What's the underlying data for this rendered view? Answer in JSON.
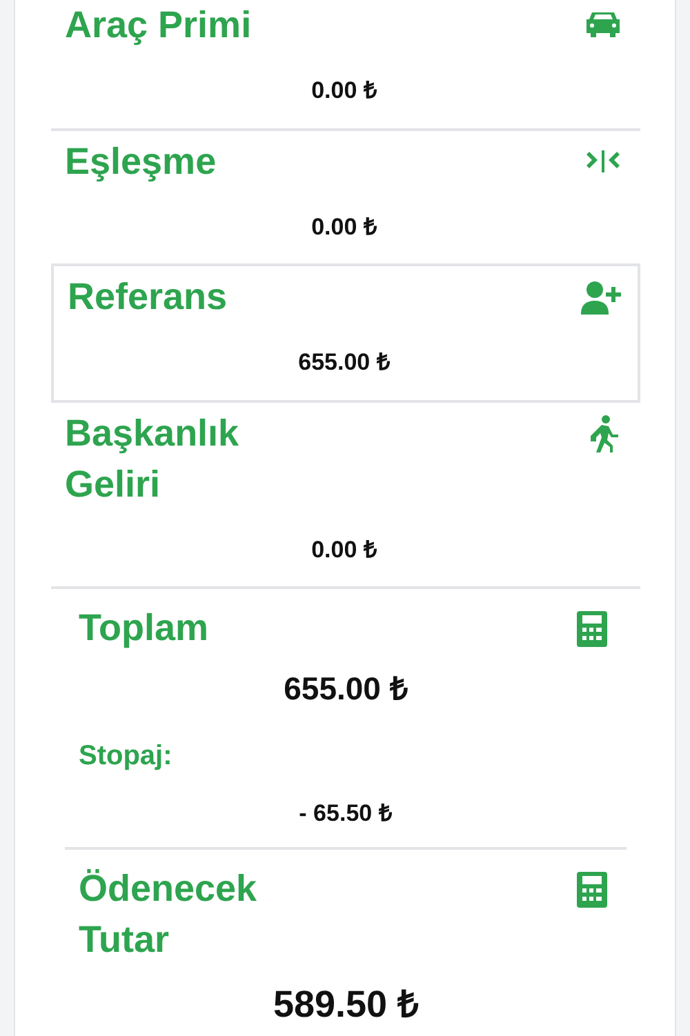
{
  "earnings": [
    {
      "kind": "vehicle",
      "title": "Araç Primi",
      "amount": "0.00 ₺",
      "boxed": false
    },
    {
      "kind": "matching",
      "title": "Eşleşme",
      "amount": "0.00 ₺",
      "boxed": false
    },
    {
      "kind": "referral",
      "title": "Referans",
      "amount": "655.00 ₺",
      "boxed": true
    },
    {
      "kind": "presidency",
      "title": "Başkanlık Geliri",
      "amount": "0.00 ₺",
      "boxed": false
    }
  ],
  "total": {
    "title": "Toplam",
    "amount": "655.00 ₺",
    "withholding_label": "Stopaj:",
    "withholding_amount": "- 65.50 ₺"
  },
  "payable": {
    "title": "Ödenecek Tutar",
    "amount": "589.50 ₺"
  }
}
